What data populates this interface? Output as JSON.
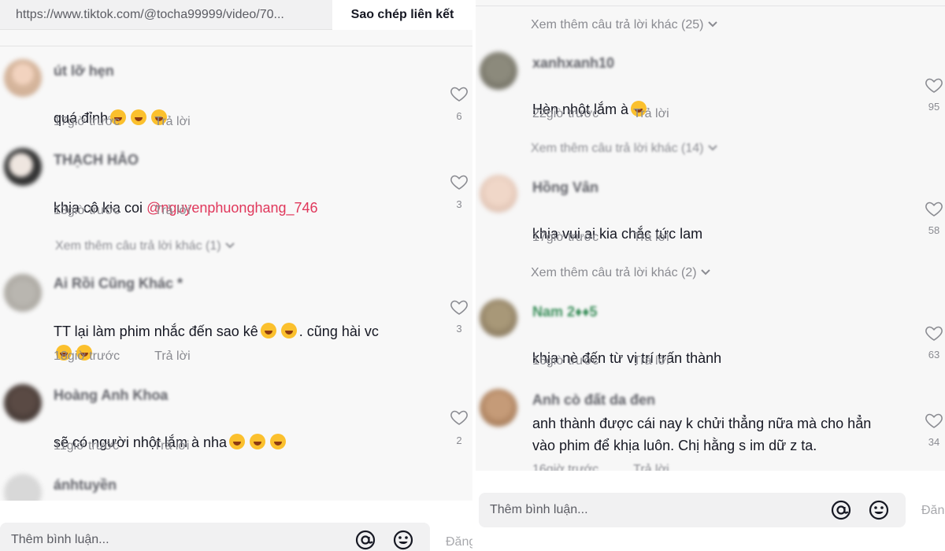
{
  "left": {
    "url": "https://www.tiktok.com/@tocha99999/video/70...",
    "copy_label": "Sao chép liên kết",
    "comments": [
      {
        "user": "út lỡ hẹn",
        "text": "quá đỉnh",
        "time": "17giờ trước",
        "reply": "Trả lời",
        "likes": "6"
      },
      {
        "user": "THẠCH HẢO",
        "text": "khịa cô kia coi ",
        "mention": "@nguyenphuonghang_746",
        "time": "13giờ trước",
        "reply": "Trả lời",
        "likes": "3"
      },
      {
        "user": "Ai Rồi Cũng Khác *",
        "text": "TT lại làm phim nhắc đến sao kê",
        "text2": ". cũng hài vc",
        "time": "18giờ trước",
        "reply": "Trả lời",
        "likes": "3"
      },
      {
        "user": "Hoàng Anh Khoa",
        "text": "sẽ có người nhột lắm à nha",
        "time": "11giờ trước",
        "reply": "Trả lời",
        "likes": "2"
      },
      {
        "user": "ánhtuyền"
      }
    ],
    "more_replies": "Xem thêm câu trả lời khác (1)",
    "input_placeholder": "Thêm bình luận...",
    "post_label": "Đăng"
  },
  "right": {
    "more_replies_top": "Xem thêm câu trả lời khác (25)",
    "comments": [
      {
        "user": "xanhxanh10",
        "text": "Hèn nhột lắm à",
        "time": "22giờ trước",
        "reply": "Trả lời",
        "likes": "95"
      },
      {
        "user": "Hồng Vân",
        "text": "khia vui ai kia chắc tức lam",
        "time": "17giờ trước",
        "reply": "Trả lời",
        "likes": "58"
      },
      {
        "user": "Nam 2♦♦5",
        "text": "khịa nè đến từ vị trí trấn thành",
        "time": "16giờ trước",
        "reply": "Trả lời",
        "likes": "63"
      },
      {
        "user": "Anh cò đất da đen",
        "text": "anh thành được cái nay k chửi thẳng nữa mà cho hẳn\nvào phim để khịa luôn. Chị hằng s im dữ z ta.",
        "time": "16giờ trước",
        "reply": "Trả lời",
        "likes": "34"
      }
    ],
    "more_replies_1": "Xem thêm câu trả lời khác (14)",
    "more_replies_2": "Xem thêm câu trả lời khác (2)",
    "input_placeholder": "Thêm bình luận...",
    "post_label": "Đăn"
  },
  "icons": {
    "heart": "heart-outline-icon",
    "mention": "at-sign-icon",
    "emoji": "smiley-icon",
    "chevron": "chevron-down-icon"
  },
  "colors": {
    "mention": "#e0375b",
    "emoji": "#fbc02d",
    "heart": "#8a8b91"
  }
}
